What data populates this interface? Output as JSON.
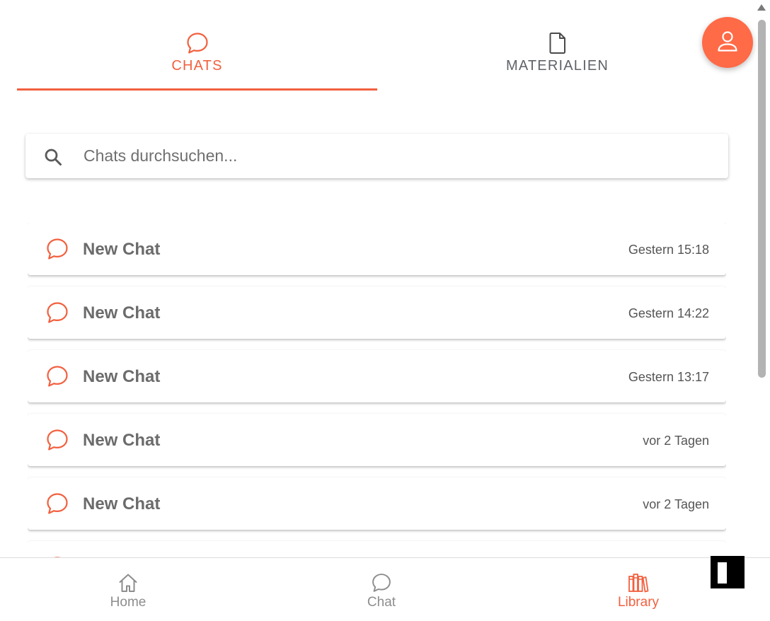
{
  "tabs": [
    {
      "label": "CHATS",
      "icon": "chat-bubble-icon",
      "active": true
    },
    {
      "label": "MATERIALIEN",
      "icon": "document-icon",
      "active": false
    }
  ],
  "search": {
    "placeholder": "Chats durchsuchen...",
    "value": ""
  },
  "chats": [
    {
      "title": "New Chat",
      "time": "Gestern 15:18"
    },
    {
      "title": "New Chat",
      "time": "Gestern 14:22"
    },
    {
      "title": "New Chat",
      "time": "Gestern 13:17"
    },
    {
      "title": "New Chat",
      "time": "vor 2 Tagen"
    },
    {
      "title": "New Chat",
      "time": "vor 2 Tagen"
    },
    {
      "title": "",
      "time": ""
    }
  ],
  "bottom_nav": [
    {
      "label": "Home",
      "icon": "home-icon",
      "active": false
    },
    {
      "label": "Chat",
      "icon": "chat-bubble-icon",
      "active": false
    },
    {
      "label": "Library",
      "icon": "library-books-icon",
      "active": true
    }
  ],
  "colors": {
    "accent": "#f2603f",
    "fab": "#ff6a47",
    "inactive": "#8d8d8d",
    "text": "#6b6b6b"
  }
}
